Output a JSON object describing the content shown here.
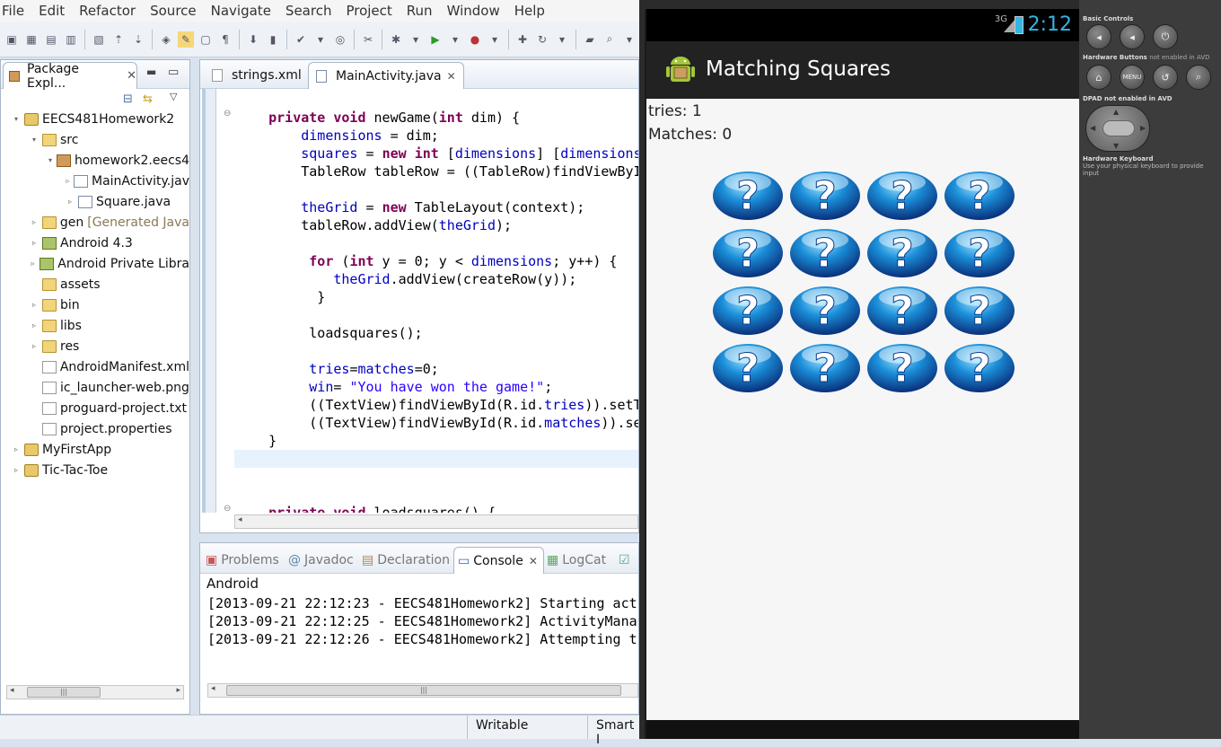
{
  "menu": [
    "File",
    "Edit",
    "Refactor",
    "Source",
    "Navigate",
    "Search",
    "Project",
    "Run",
    "Window",
    "Help"
  ],
  "package_explorer": {
    "tab_label": "Package Expl...",
    "tree": [
      {
        "label": "EECS481Homework2",
        "level": 0,
        "arrow": "▾",
        "icon": "proj"
      },
      {
        "label": "src",
        "level": 1,
        "arrow": "▾",
        "icon": "folder"
      },
      {
        "label": "homework2.eecs4",
        "level": 2,
        "arrow": "▾",
        "icon": "pkg"
      },
      {
        "label": "MainActivity.jav",
        "level": 3,
        "arrow": "▹",
        "icon": "java"
      },
      {
        "label": "Square.java",
        "level": 3,
        "arrow": "▹",
        "icon": "java"
      },
      {
        "label": "gen",
        "suffix": "[Generated Java",
        "level": 1,
        "arrow": "▹",
        "icon": "folder"
      },
      {
        "label": "Android 4.3",
        "level": 1,
        "arrow": "▹",
        "icon": "lib"
      },
      {
        "label": "Android Private Libra",
        "level": 1,
        "arrow": "▹",
        "icon": "lib"
      },
      {
        "label": "assets",
        "level": 1,
        "arrow": "",
        "icon": "folder"
      },
      {
        "label": "bin",
        "level": 1,
        "arrow": "▹",
        "icon": "folder"
      },
      {
        "label": "libs",
        "level": 1,
        "arrow": "▹",
        "icon": "folder"
      },
      {
        "label": "res",
        "level": 1,
        "arrow": "▹",
        "icon": "folder"
      },
      {
        "label": "AndroidManifest.xml",
        "level": 1,
        "arrow": "",
        "icon": "file"
      },
      {
        "label": "ic_launcher-web.png",
        "level": 1,
        "arrow": "",
        "icon": "file"
      },
      {
        "label": "proguard-project.txt",
        "level": 1,
        "arrow": "",
        "icon": "file"
      },
      {
        "label": "project.properties",
        "level": 1,
        "arrow": "",
        "icon": "file"
      },
      {
        "label": "MyFirstApp",
        "level": 0,
        "arrow": "▹",
        "icon": "proj"
      },
      {
        "label": "Tic-Tac-Toe",
        "level": 0,
        "arrow": "▹",
        "icon": "proj"
      }
    ]
  },
  "editor": {
    "tabs": [
      "strings.xml",
      "MainActivity.java"
    ],
    "lines": [
      "    private void newGame(int dim) {",
      "        dimensions = dim;",
      "        squares = new int [dimensions] [dimensions",
      "        TableRow tableRow = ((TableRow)findViewById",
      "",
      "        theGrid = new TableLayout(context);",
      "        tableRow.addView(theGrid);",
      "",
      "         for (int y = 0; y < dimensions; y++) {",
      "            theGrid.addView(createRow(y));",
      "          }",
      "",
      "         loadsquares();",
      "",
      "         tries=matches=0;",
      "         win= \"You have won the game!\";",
      "         ((TextView)findViewById(R.id.tries)).setT",
      "         ((TextView)findViewById(R.id.matches)).se",
      "    }",
      "",
      "",
      "",
      "    private void loadsquares() {"
    ]
  },
  "console": {
    "tabs": [
      "Problems",
      "Javadoc",
      "Declaration",
      "Console",
      "LogCat"
    ],
    "active_tab": "Console",
    "header": "Android",
    "lines": [
      "[2013-09-21 22:12:23 - EECS481Homework2] Starting act",
      "[2013-09-21 22:12:25 - EECS481Homework2] ActivityMana",
      "[2013-09-21 22:12:26 - EECS481Homework2] Attempting t"
    ]
  },
  "statusbar": {
    "writable": "Writable",
    "insert": "Smart I"
  },
  "emulator": {
    "clock": "2:12",
    "network": "3G",
    "app_title": "Matching Squares",
    "tries": "tries: 1",
    "matches": "Matches: 0",
    "grid_rows": 4,
    "grid_cols": 4,
    "square_icon": "question-mark-icon",
    "controls": {
      "basic": "Basic Controls",
      "hw_buttons": "Hardware Buttons",
      "hw_buttons_note": "not enabled in AVD",
      "dpad": "DPAD not enabled in AVD",
      "keyboard": "Hardware Keyboard",
      "keyboard_note": "Use your physical keyboard to provide input",
      "menu_label": "MENU"
    }
  },
  "colors": {
    "accent": "#33b5e5",
    "keyword": "#7f0055",
    "field": "#0000c0",
    "string": "#2a00ff"
  }
}
